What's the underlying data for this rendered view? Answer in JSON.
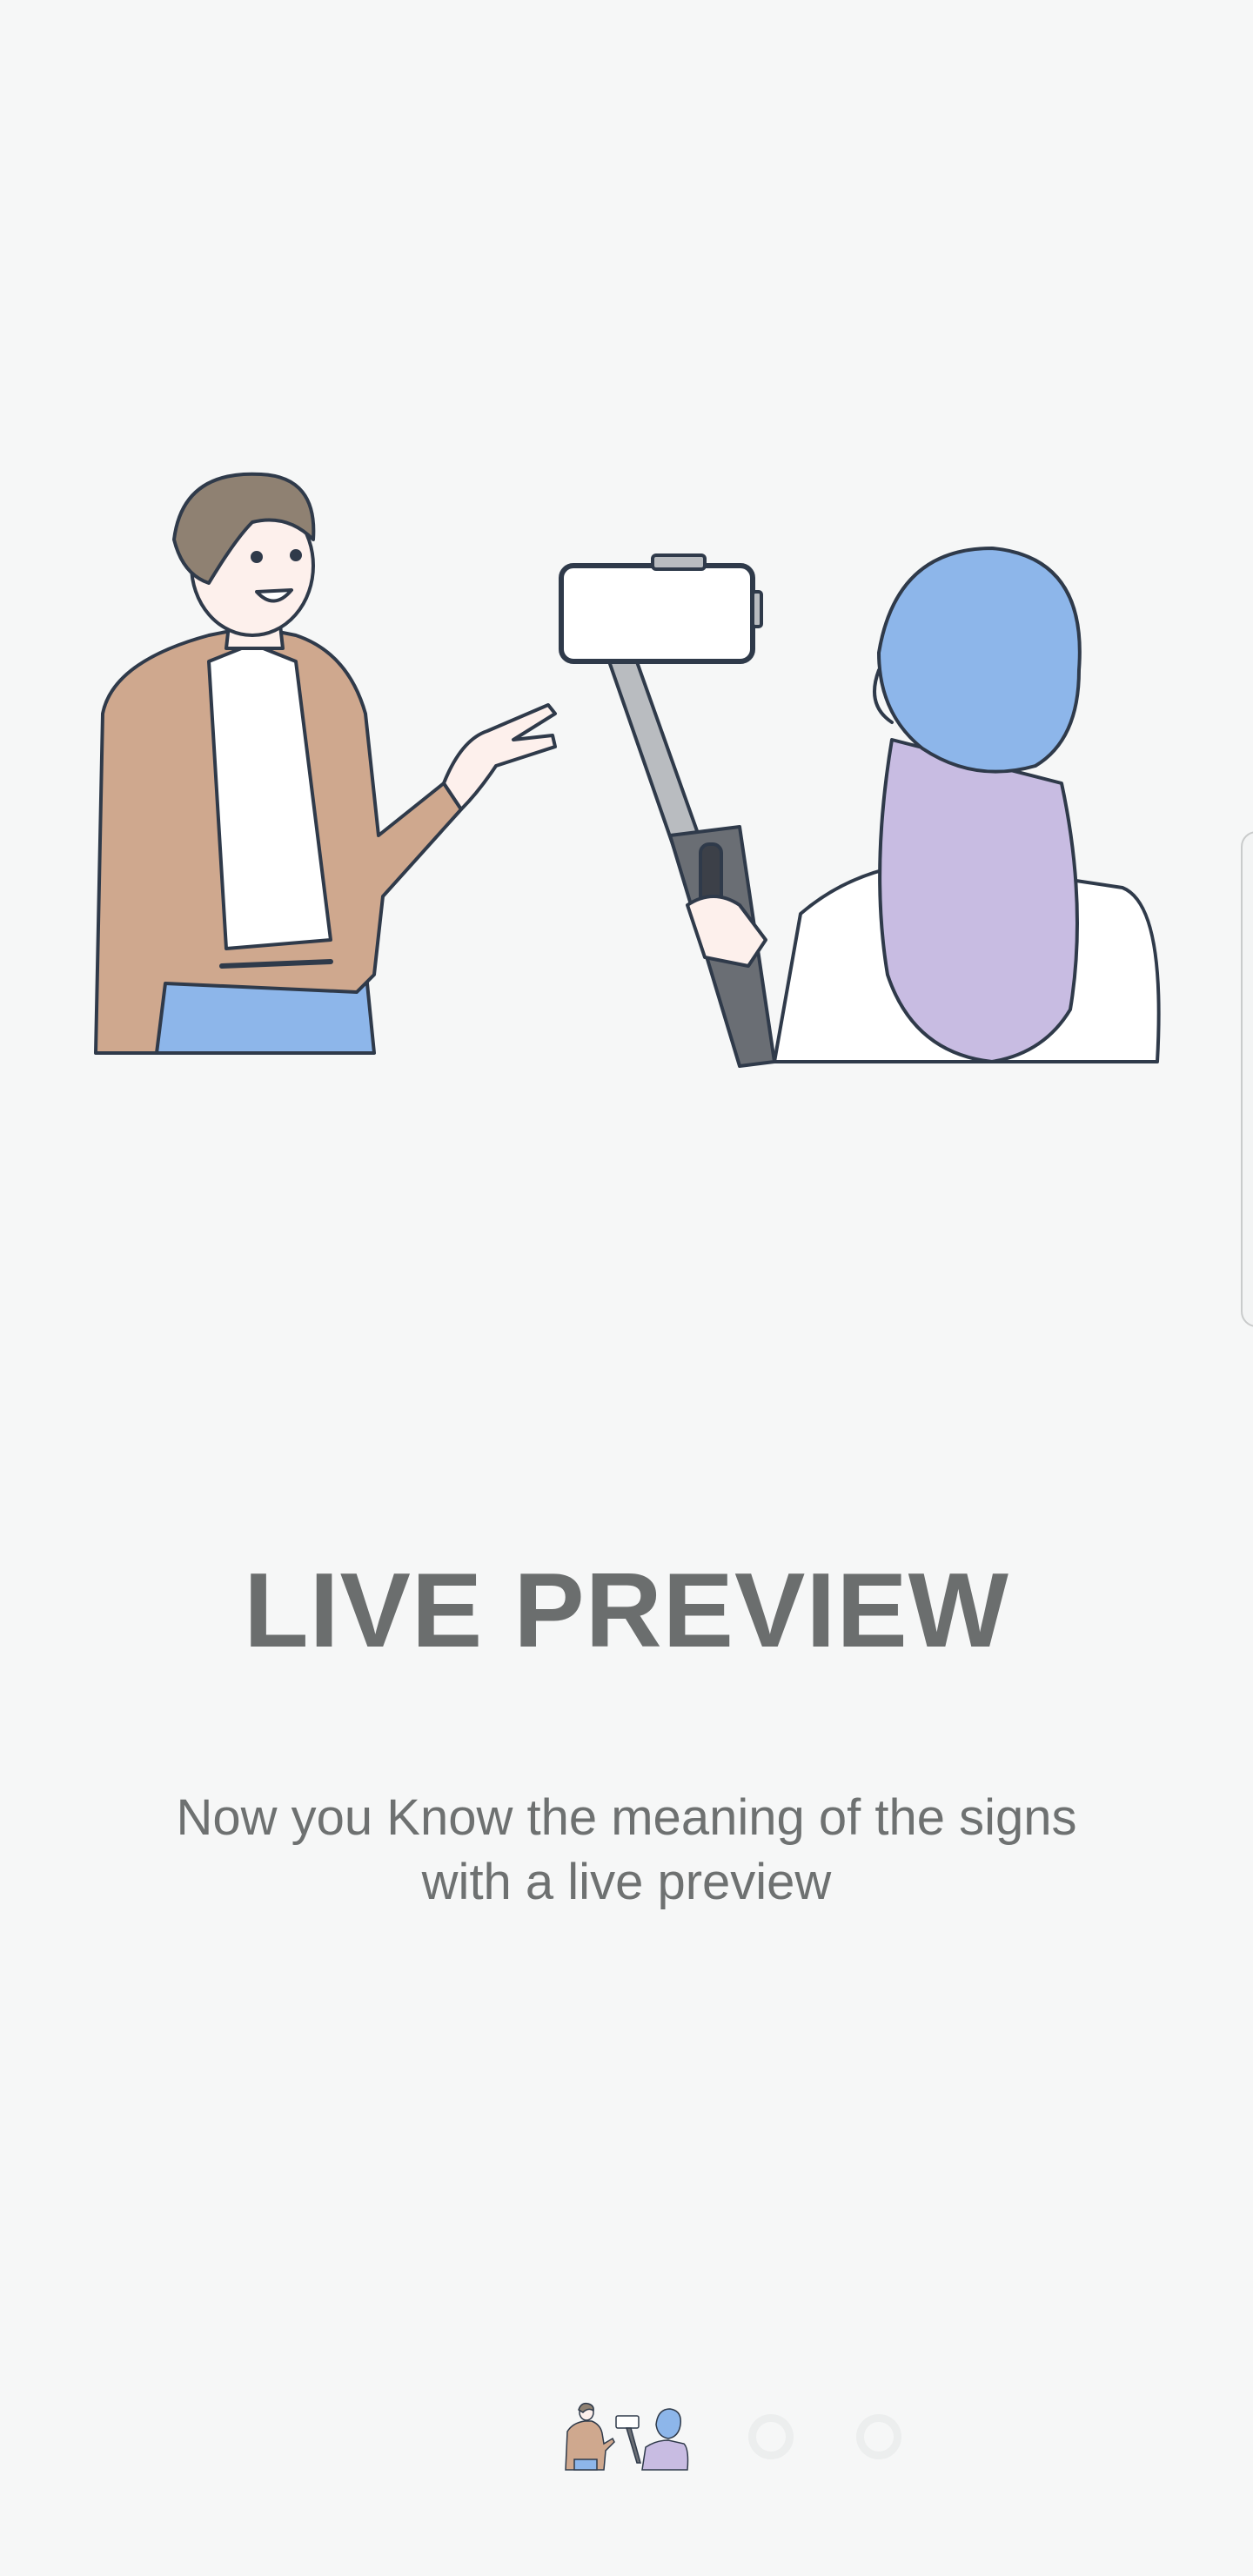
{
  "onboarding": {
    "title": "LIVE PREVIEW",
    "description_line1": "Now you Know the meaning of the signs",
    "description_line2": "with a live preview",
    "illustration": {
      "icon": "illustration-presenter-and-camerawoman",
      "colors": {
        "jacket": "#cfa88e",
        "hair_man": "#8f8172",
        "jeans": "#8db6ea",
        "hair_blue": "#8db6ea",
        "hair_purple": "#c8bce2",
        "outline": "#2f3a4a"
      }
    },
    "pager": {
      "total_pages": 3,
      "current_page": 1,
      "active_icon": "mini-illustration-thumbnail-icon",
      "inactive_icon": "page-dot-icon"
    }
  },
  "colors": {
    "background": "#f6f7f7",
    "title": "#6b6e6e",
    "text": "#6e7171"
  }
}
